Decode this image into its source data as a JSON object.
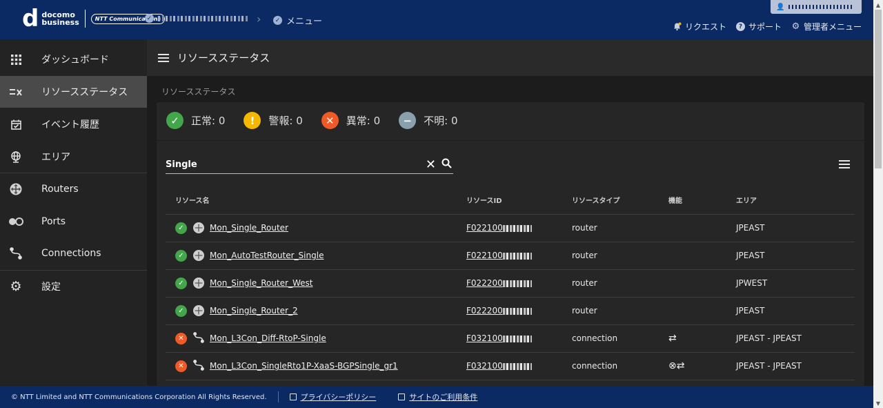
{
  "header": {
    "logo_mark": "d",
    "logo_line1": "docomo",
    "logo_line2": "business",
    "logo_partner": "NTT Communications",
    "breadcrumb_menu": "メニュー",
    "links": [
      {
        "label": "リクエスト",
        "icon": "bell-icon"
      },
      {
        "label": "サポート",
        "icon": "help-icon"
      },
      {
        "label": "管理者メニュー",
        "icon": "gear-icon"
      }
    ]
  },
  "sidebar": {
    "items": [
      {
        "label": "ダッシュボード",
        "icon": "grid-icon"
      },
      {
        "label": "リソースステータス",
        "icon": "status-list-icon",
        "active": true
      },
      {
        "label": "イベント履歴",
        "icon": "calendar-icon"
      },
      {
        "label": "エリア",
        "icon": "globe-icon"
      },
      {
        "label": "Routers",
        "icon": "router-icon"
      },
      {
        "label": "Ports",
        "icon": "ports-icon"
      },
      {
        "label": "Connections",
        "icon": "connection-icon"
      },
      {
        "label": "設定",
        "icon": "gear-icon"
      }
    ]
  },
  "page": {
    "title": "リソースステータス",
    "subtitle": "リソースステータス"
  },
  "status_summary": [
    {
      "label": "正常: 0",
      "kind": "ok",
      "color": "#44a64a"
    },
    {
      "label": "警報: 0",
      "kind": "warn",
      "color": "#f5b800"
    },
    {
      "label": "異常: 0",
      "kind": "error",
      "color": "#ef5a26"
    },
    {
      "label": "不明: 0",
      "kind": "unknown",
      "color": "#8aa0ad"
    }
  ],
  "search": {
    "value": "Single"
  },
  "table": {
    "headers": [
      "リソース名",
      "リソースID",
      "リソースタイプ",
      "機能",
      "エリア"
    ],
    "rows": [
      {
        "status": "ok",
        "name": "Mon_Single_Router",
        "id_prefix": "F022100",
        "type": "router",
        "function": "",
        "area": "JPEAST"
      },
      {
        "status": "ok",
        "name": "Mon_AutoTestRouter_Single",
        "id_prefix": "F022100",
        "type": "router",
        "function": "",
        "area": "JPEAST"
      },
      {
        "status": "ok",
        "name": "Mon_Single_Router_West",
        "id_prefix": "F022200",
        "type": "router",
        "function": "",
        "area": "JPWEST"
      },
      {
        "status": "ok",
        "name": "Mon_Single_Router_2",
        "id_prefix": "F022200",
        "type": "router",
        "function": "",
        "area": "JPEAST"
      },
      {
        "status": "error",
        "name": "Mon_L3Con_Diff-RtoP-Single",
        "id_prefix": "F032100",
        "type": "connection",
        "function": "⇄",
        "area": "JPEAST - JPEAST"
      },
      {
        "status": "error",
        "name": "Mon_L3Con_SingleRto1P-XaaS-BGPSingle_gr1",
        "id_prefix": "F032100",
        "type": "connection",
        "function": "⊗⇄",
        "area": "JPEAST - JPEAST"
      }
    ]
  },
  "footer": {
    "copyright": "© NTT Limited and NTT Communications Corporation All Rights Reserved.",
    "privacy": "プライバシーポリシー",
    "terms": "サイトのご利用条件"
  }
}
